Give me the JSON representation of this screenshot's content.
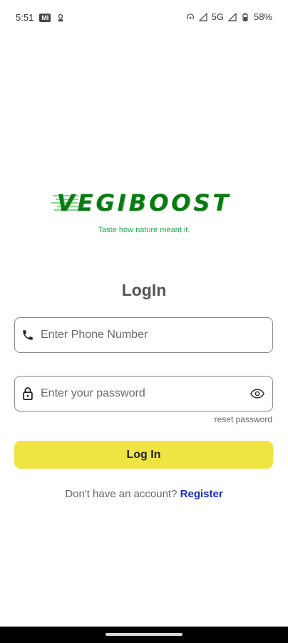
{
  "status_bar": {
    "time": "5:51",
    "mi_badge": "MI",
    "network": "5G",
    "battery": "58%"
  },
  "logo": {
    "brand": "VEGIBOOST",
    "tagline": "Taste how nature meant it.",
    "color": "#0a7b12"
  },
  "login": {
    "title": "LogIn",
    "phone_placeholder": "Enter Phone Number",
    "password_placeholder": "Enter your password",
    "reset_label": "reset password",
    "button_label": "Log In",
    "register_prompt": "Don't have an account? ",
    "register_label": "Register"
  },
  "icons": {
    "phone": "phone-icon",
    "lock": "lock-icon",
    "eye": "eye-icon"
  },
  "colors": {
    "button_bg": "#f0e443",
    "register_link": "#1a2fbf",
    "tagline": "#1aa84a"
  }
}
